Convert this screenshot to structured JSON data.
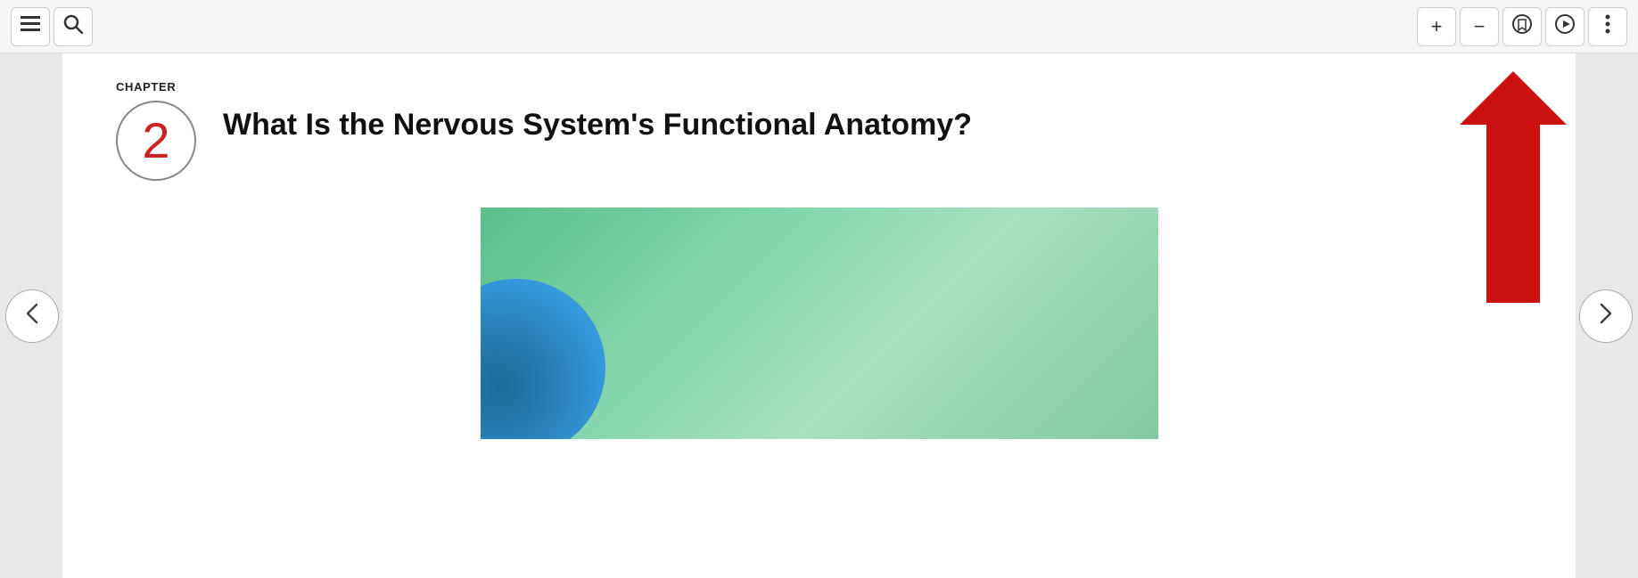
{
  "toolbar": {
    "menu_icon": "≡",
    "search_icon": "🔍",
    "zoom_in": "+",
    "zoom_out": "−",
    "bookmark_icon": "⊕",
    "play_icon": "▷",
    "more_icon": "⋮"
  },
  "chapter": {
    "label": "CHAPTER",
    "number": "2",
    "title": "What Is the Nervous System's Functional Anatomy?"
  },
  "navigation": {
    "prev_icon": "‹",
    "next_icon": "›"
  }
}
